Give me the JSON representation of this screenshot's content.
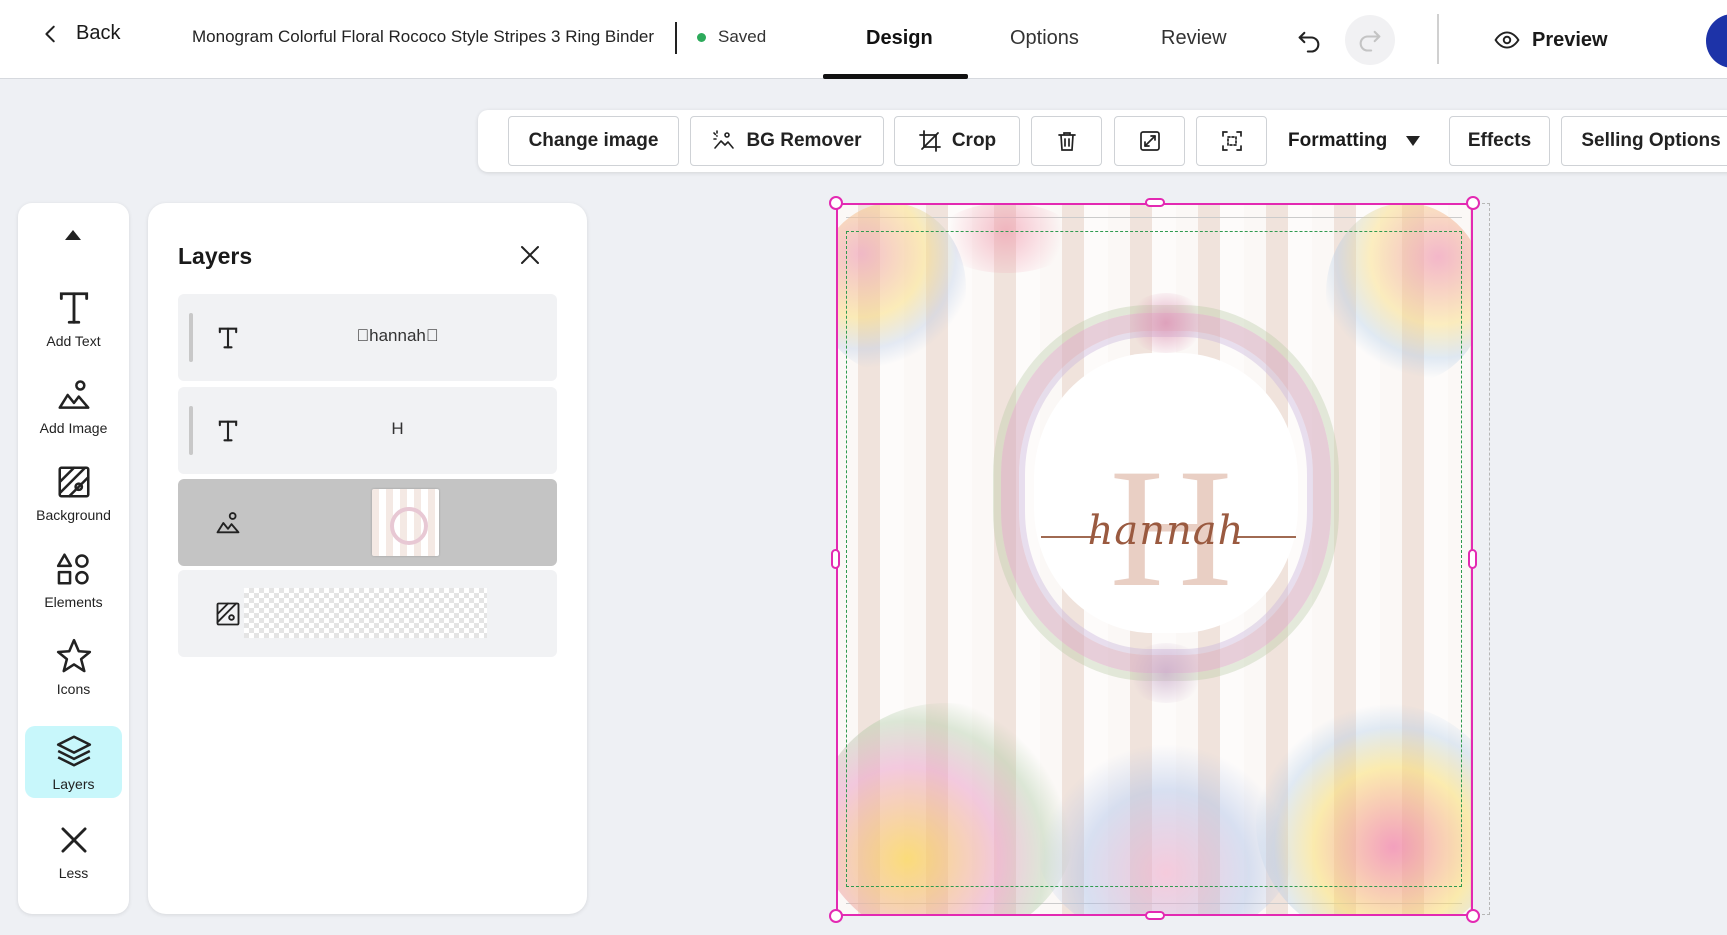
{
  "topbar": {
    "back_label": "Back",
    "doc_title": "Monogram Colorful Floral Rococo Style Stripes 3 Ring Binder",
    "saved_label": "Saved",
    "tabs": [
      {
        "label": "Design",
        "active": true
      },
      {
        "label": "Options",
        "active": false
      },
      {
        "label": "Review",
        "active": false
      }
    ],
    "preview_label": "Preview",
    "colors": {
      "saved_dot": "#2daa5b",
      "avatar": "#1d33a8"
    }
  },
  "toolbar": {
    "change_image": "Change image",
    "bg_remover": "BG Remover",
    "crop": "Crop",
    "formatting": "Formatting",
    "effects": "Effects",
    "selling_options": "Selling Options",
    "icons": [
      "bg-remover-icon",
      "crop-icon",
      "trash-icon",
      "expand-icon",
      "fit-frame-icon",
      "caret-down-icon"
    ]
  },
  "rail": {
    "items": [
      {
        "label": "Add Text",
        "icon": "text-t-icon"
      },
      {
        "label": "Add Image",
        "icon": "image-add-icon"
      },
      {
        "label": "Background",
        "icon": "background-icon"
      },
      {
        "label": "Elements",
        "icon": "shapes-icon"
      },
      {
        "label": "Icons",
        "icon": "star-icon"
      },
      {
        "label": "Layers",
        "icon": "layers-icon",
        "active": true
      },
      {
        "label": "Less",
        "icon": "close-icon"
      }
    ],
    "active_color": "#c8f7fb"
  },
  "layers": {
    "title": "Layers",
    "rows": [
      {
        "type": "text",
        "label": "hannah"
      },
      {
        "type": "text",
        "label": "H"
      },
      {
        "type": "image",
        "selected": true
      },
      {
        "type": "background"
      }
    ]
  },
  "canvas": {
    "monogram_letter": "H",
    "monogram_name": "hannah",
    "selection_color": "#e329b2",
    "safe_zone_color": "#2f9a4f"
  }
}
